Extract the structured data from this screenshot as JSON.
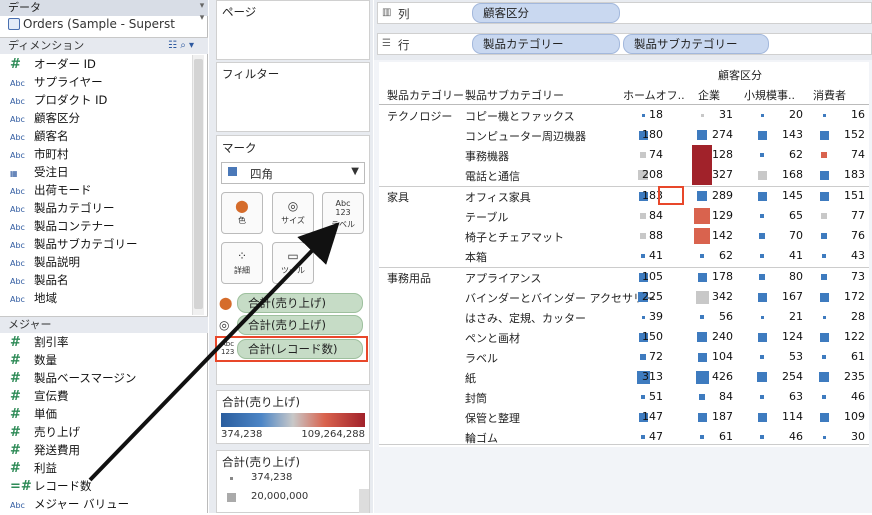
{
  "data_pane": {
    "title": "データ",
    "datasource": "Orders (Sample - Superst",
    "dimensions_header": "ディメンション",
    "dimensions": [
      {
        "type": "#",
        "name": "オーダー ID"
      },
      {
        "type": "Abc",
        "name": "サプライヤー"
      },
      {
        "type": "Abc",
        "name": "プロダクト ID"
      },
      {
        "type": "Abc",
        "name": "顧客区分"
      },
      {
        "type": "Abc",
        "name": "顧客名"
      },
      {
        "type": "Abc",
        "name": "市町村"
      },
      {
        "type": "date",
        "name": "受注日"
      },
      {
        "type": "Abc",
        "name": "出荷モード"
      },
      {
        "type": "Abc",
        "name": "製品カテゴリー"
      },
      {
        "type": "Abc",
        "name": "製品コンテナー"
      },
      {
        "type": "Abc",
        "name": "製品サブカテゴリー"
      },
      {
        "type": "Abc",
        "name": "製品説明"
      },
      {
        "type": "Abc",
        "name": "製品名"
      },
      {
        "type": "Abc",
        "name": "地域"
      }
    ],
    "measures_header": "メジャー",
    "measures": [
      {
        "type": "#",
        "name": "割引率"
      },
      {
        "type": "#",
        "name": "数量"
      },
      {
        "type": "#",
        "name": "製品ベースマージン"
      },
      {
        "type": "#",
        "name": "宣伝費"
      },
      {
        "type": "#",
        "name": "単価"
      },
      {
        "type": "#",
        "name": "売り上げ"
      },
      {
        "type": "#",
        "name": "発送費用"
      },
      {
        "type": "#",
        "name": "利益"
      },
      {
        "type": "=#",
        "name": "レコード数"
      },
      {
        "type": "Abc",
        "name": "メジャー バリュー"
      }
    ]
  },
  "pages_label": "ページ",
  "filters_label": "フィルター",
  "marks": {
    "label": "マーク",
    "mark_type": "四角",
    "buttons": {
      "color": "色",
      "size": "サイズ",
      "label": "ラベル",
      "detail": "詳細",
      "tooltip": "ツール"
    },
    "pills": [
      "合計(売り上げ)",
      "合計(売り上げ)",
      "合計(レコード数)"
    ]
  },
  "legend1": {
    "title": "合計(売り上げ)",
    "min": "374,238",
    "max": "109,264,288"
  },
  "legend2": {
    "title": "合計(売り上げ)",
    "items": [
      "374,238",
      "20,000,000"
    ]
  },
  "columns_shelf": {
    "label": "列",
    "pill": "顧客区分"
  },
  "rows_shelf": {
    "label": "行",
    "pills": [
      "製品カテゴリー",
      "製品サブカテゴリー"
    ]
  },
  "view": {
    "top_header": "顧客区分",
    "row_headers": [
      "製品カテゴリー",
      "製品サブカテゴリー"
    ],
    "col_headers": [
      "ホームオフ..",
      "企業",
      "小規模事..",
      "消費者"
    ],
    "categories": [
      "テクノロジー",
      "家具",
      "事務用品"
    ],
    "rows": [
      {
        "sub": "コピー機とファックス",
        "v": [
          "18",
          "31",
          "20",
          "16"
        ]
      },
      {
        "sub": "コンピューター周辺機器",
        "v": [
          "180",
          "274",
          "143",
          "152"
        ]
      },
      {
        "sub": "事務機器",
        "v": [
          "74",
          "128",
          "62",
          "74"
        ]
      },
      {
        "sub": "電話と通信",
        "v": [
          "208",
          "327",
          "168",
          "183"
        ]
      },
      {
        "sub": "オフィス家具",
        "v": [
          "183",
          "289",
          "145",
          "151"
        ]
      },
      {
        "sub": "テーブル",
        "v": [
          "84",
          "129",
          "65",
          "77"
        ]
      },
      {
        "sub": "椅子とチェアマット",
        "v": [
          "88",
          "142",
          "70",
          "76"
        ]
      },
      {
        "sub": "本箱",
        "v": [
          "41",
          "62",
          "41",
          "43"
        ]
      },
      {
        "sub": "アプライアンス",
        "v": [
          "105",
          "178",
          "80",
          "73"
        ]
      },
      {
        "sub": "バインダーとバインダー アクセサリー",
        "v": [
          "225",
          "342",
          "167",
          "172"
        ]
      },
      {
        "sub": "はさみ、定規、カッター",
        "v": [
          "39",
          "56",
          "21",
          "28"
        ]
      },
      {
        "sub": "ペンと画材",
        "v": [
          "150",
          "240",
          "124",
          "122"
        ]
      },
      {
        "sub": "ラベル",
        "v": [
          "72",
          "104",
          "53",
          "61"
        ]
      },
      {
        "sub": "紙",
        "v": [
          "313",
          "426",
          "254",
          "235"
        ]
      },
      {
        "sub": "封筒",
        "v": [
          "51",
          "84",
          "63",
          "46"
        ]
      },
      {
        "sub": "保管と整理",
        "v": [
          "147",
          "187",
          "114",
          "109"
        ]
      },
      {
        "sub": "輪ゴム",
        "v": [
          "47",
          "61",
          "46",
          "30"
        ]
      }
    ],
    "colors": {
      "blue": "#3e7bbf",
      "grey": "#c8c8c8",
      "darkred": "#a1222a",
      "red": "#d9634e",
      "highlight": "#e8472a"
    }
  }
}
